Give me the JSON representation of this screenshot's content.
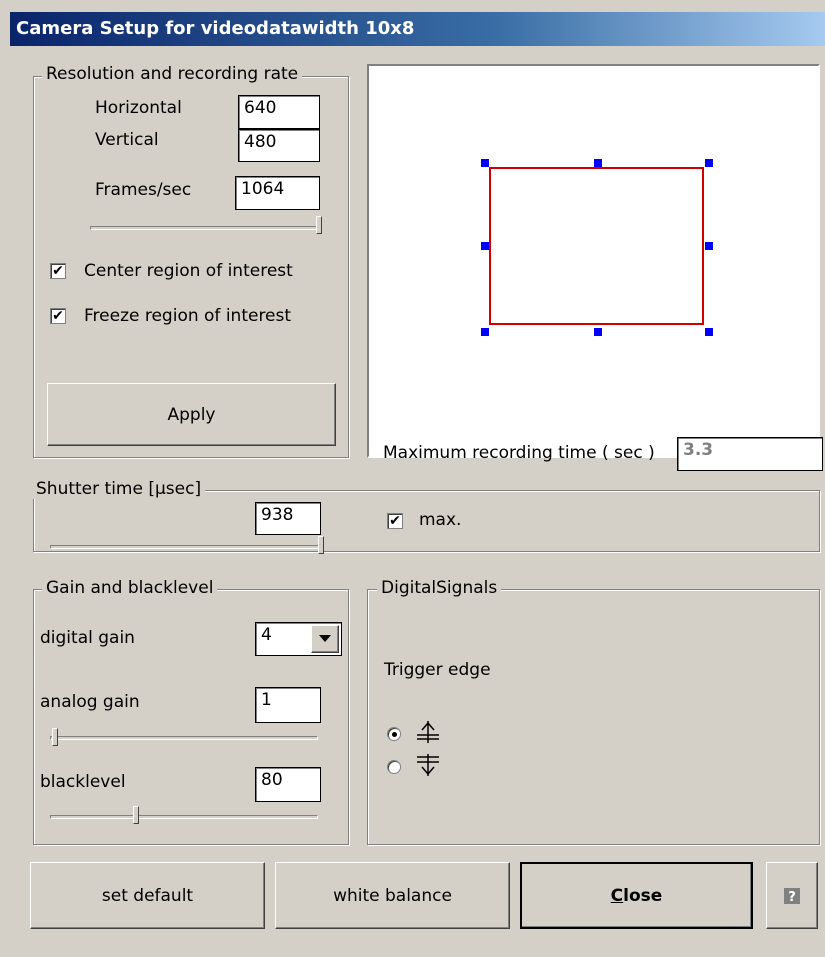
{
  "window": {
    "title": "Camera Setup for videodatawidth 10x8"
  },
  "resolution": {
    "legend": "Resolution and recording rate",
    "horizontal_label": "Horizontal",
    "horizontal_value": "640",
    "vertical_label": "Vertical",
    "vertical_value": "480",
    "fps_label": "Frames/sec",
    "fps_value": "1064",
    "fps_slider_level": 1.0,
    "center_roi": {
      "label": "Center region of interest",
      "checked": true
    },
    "freeze_roi": {
      "label": "Freeze region of interest",
      "checked": true
    },
    "apply_label": "Apply"
  },
  "preview": {
    "roi_color": "#d00000",
    "handle_color": "#0000ff"
  },
  "max_recording": {
    "label": "Maximum recording time ( sec )",
    "value": "3.3"
  },
  "shutter": {
    "legend": "Shutter time [µsec]",
    "value": "938",
    "slider_level": 1.0,
    "max": {
      "label": "max.",
      "checked": true
    }
  },
  "gain": {
    "legend": "Gain and blacklevel",
    "digital_gain_label": "digital gain",
    "digital_gain_value": "4",
    "analog_gain_label": "analog gain",
    "analog_gain_value": "1",
    "analog_slider_level": 0.0,
    "blacklevel_label": "blacklevel",
    "blacklevel_value": "80",
    "blacklevel_slider_level": 0.31
  },
  "digital_signals": {
    "legend": "DigitalSignals",
    "trigger_edge_label": "Trigger edge",
    "options": [
      {
        "icon": "rising-edge-icon",
        "selected": true
      },
      {
        "icon": "falling-edge-icon",
        "selected": false
      }
    ]
  },
  "buttons": {
    "set_default": "set default",
    "white_balance": "white balance",
    "close": "Close",
    "help_icon": "help-icon"
  }
}
